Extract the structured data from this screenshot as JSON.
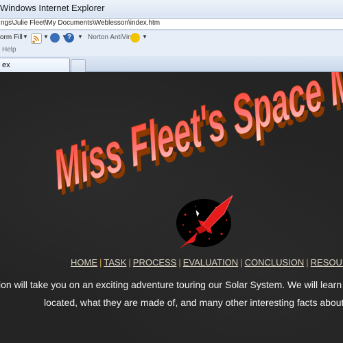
{
  "window": {
    "title": "Windows Internet Explorer"
  },
  "address": {
    "url": "ngs\\Julie Fleet\\My Documents\\Weblesson\\index.htm"
  },
  "toolbar": {
    "form_fill": "orm Fill",
    "norton": "Norton AntiVirus"
  },
  "menu": {
    "help": "Help"
  },
  "tabs": [
    {
      "label": "ex"
    }
  ],
  "page": {
    "heading": "Miss Fleet's Space Mission",
    "nav": [
      "HOME",
      "TASK",
      "PROCESS",
      "EVALUATION",
      "CONCLUSION",
      "RESOURCES"
    ],
    "intro_line1": "ion will take you on an exciting adventure touring our Solar System.  We will learn th",
    "intro_line2": "located, what they are made of, and many other interesting facts about th"
  }
}
